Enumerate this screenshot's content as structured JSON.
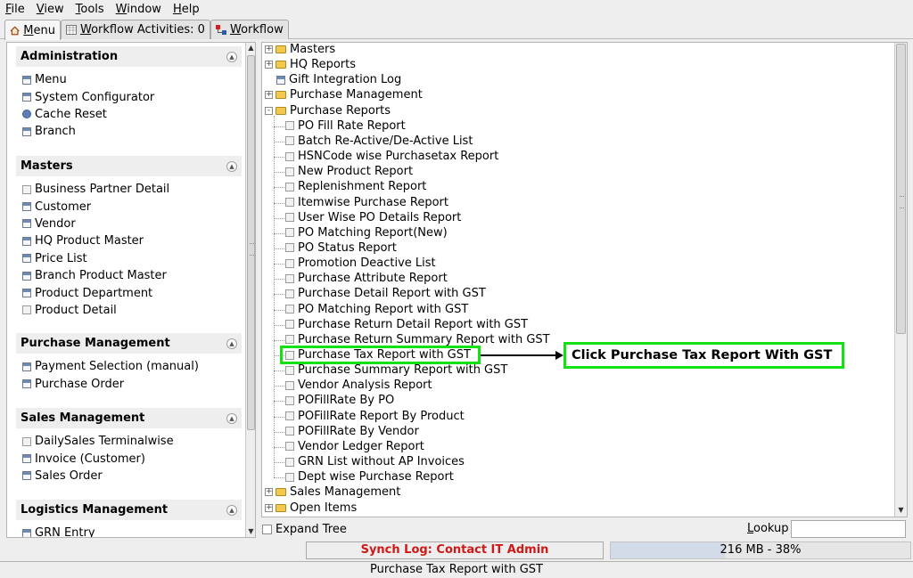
{
  "menubar": {
    "items": [
      "File",
      "View",
      "Tools",
      "Window",
      "Help"
    ]
  },
  "tabs": [
    {
      "label": "Menu",
      "icon": "home-icon"
    },
    {
      "label": "Workflow Activities: 0",
      "icon": "calendar-icon"
    },
    {
      "label": "Workflow",
      "icon": "workflow-icon"
    }
  ],
  "left_panel": {
    "sections": [
      {
        "title": "Administration",
        "items": [
          {
            "label": "Menu",
            "icon": "window-icon"
          },
          {
            "label": "System Configurator",
            "icon": "window-icon"
          },
          {
            "label": "Cache Reset",
            "icon": "gear-icon"
          },
          {
            "label": "Branch",
            "icon": "window-icon"
          }
        ]
      },
      {
        "title": "Masters",
        "items": [
          {
            "label": "Business Partner Detail",
            "icon": "document-icon"
          },
          {
            "label": "Customer",
            "icon": "window-icon"
          },
          {
            "label": "Vendor",
            "icon": "window-icon"
          },
          {
            "label": "HQ Product Master",
            "icon": "window-icon"
          },
          {
            "label": "Price List",
            "icon": "window-icon"
          },
          {
            "label": "Branch Product Master",
            "icon": "window-icon"
          },
          {
            "label": "Product Department",
            "icon": "window-icon"
          },
          {
            "label": "Product Detail",
            "icon": "document-icon"
          }
        ]
      },
      {
        "title": "Purchase Management",
        "items": [
          {
            "label": "Payment Selection (manual)",
            "icon": "window-icon"
          },
          {
            "label": "Purchase Order",
            "icon": "window-icon"
          }
        ]
      },
      {
        "title": "Sales Management",
        "items": [
          {
            "label": "DailySales Terminalwise",
            "icon": "document-icon"
          },
          {
            "label": "Invoice (Customer)",
            "icon": "window-icon"
          },
          {
            "label": "Sales Order",
            "icon": "window-icon"
          }
        ]
      },
      {
        "title": "Logistics Management",
        "items": [
          {
            "label": "GRN Entry",
            "icon": "window-icon"
          }
        ]
      }
    ]
  },
  "tree": {
    "top_nodes": [
      {
        "label": "Masters",
        "type": "folder",
        "expanded": false
      },
      {
        "label": "HQ Reports",
        "type": "folder",
        "expanded": false
      },
      {
        "label": "Gift Integration Log",
        "type": "window",
        "expanded": false
      },
      {
        "label": "Purchase Management",
        "type": "folder",
        "expanded": false
      },
      {
        "label": "Purchase Reports",
        "type": "folder-open",
        "expanded": true
      }
    ],
    "expand_symbols": {
      "collapsed": "+",
      "expanded": "-"
    },
    "children": [
      "PO Fill Rate Report",
      "Batch Re-Active/De-Active List",
      "HSNCode wise Purchasetax Report",
      "New Product Report",
      "Replenishment Report",
      "Itemwise Purchase Report",
      "User Wise PO Details Report",
      "PO Matching Report(New)",
      "PO Status Report",
      "Promotion Deactive List",
      "Purchase Attribute Report",
      "Purchase Detail Report with GST",
      "PO Matching Report with GST",
      "Purchase Return Detail Report with GST",
      "Purchase Return Summary Report with GST",
      "Purchase Tax Report with GST",
      "Purchase Summary Report with GST",
      "Vendor Analysis Report",
      "POFillRate By PO",
      "POFillRate Report By Product",
      "POFillRate By Vendor",
      "Vendor Ledger Report",
      "GRN List without AP Invoices",
      "Dept wise Purchase Report"
    ],
    "bottom_nodes": [
      {
        "label": "Sales Management",
        "type": "folder"
      },
      {
        "label": "Open Items",
        "type": "folder"
      }
    ],
    "highlighted": "Purchase Tax Report with GST"
  },
  "annotation": {
    "text": "Click Purchase Tax Report With GST",
    "color": "#14e014"
  },
  "bottom": {
    "expand_tree_label": "Expand Tree",
    "lookup_label": "Lookup",
    "lookup_value": ""
  },
  "status": {
    "synch_log": "Synch Log: Contact IT Admin",
    "synch_color": "#d01818",
    "memory": "216 MB - 38%",
    "memory_fraction": 0.38,
    "statusbar": "Purchase Tax Report with GST"
  }
}
